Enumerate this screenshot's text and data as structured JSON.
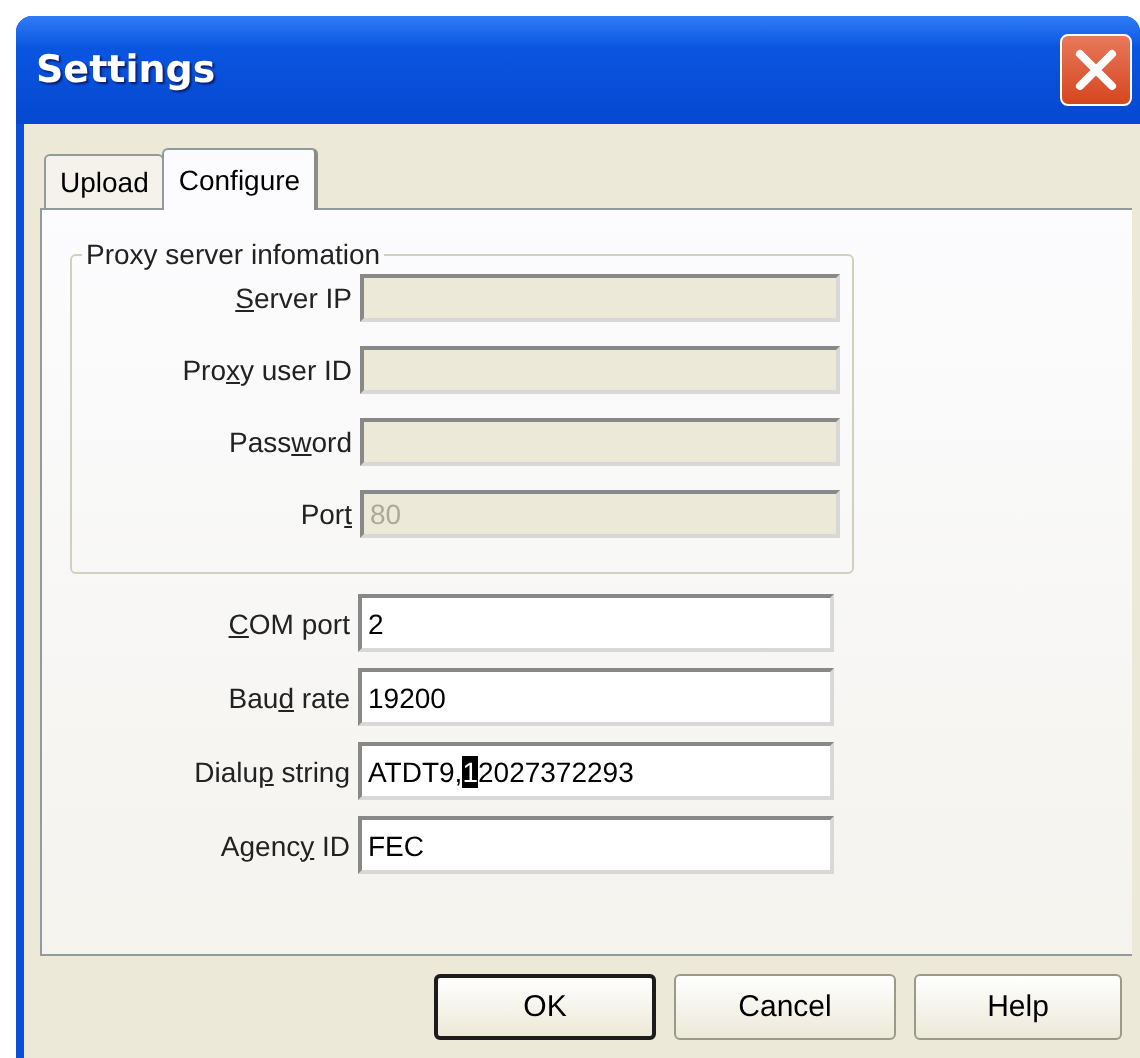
{
  "window": {
    "title": "Settings"
  },
  "tabs": [
    {
      "label": "Upload",
      "selected": false
    },
    {
      "label": "Configure",
      "selected": true
    }
  ],
  "proxy_group": {
    "title": "Proxy server infomation",
    "fields": [
      {
        "label": [
          {
            "text": "S",
            "underlined": true
          },
          {
            "text": "erver IP",
            "underlined": false
          }
        ],
        "disabled": true
      },
      {
        "label": [
          {
            "text": "Pro",
            "underlined": false
          },
          {
            "text": "x",
            "underlined": true
          },
          {
            "text": "y user ID",
            "underlined": false
          }
        ],
        "disabled": true
      },
      {
        "label": [
          {
            "text": "Pass",
            "underlined": false
          },
          {
            "text": "w",
            "underlined": true
          },
          {
            "text": "ord",
            "underlined": false
          }
        ],
        "disabled": true
      },
      {
        "label": [
          {
            "text": "Por",
            "underlined": false
          },
          {
            "text": "t",
            "underlined": true
          }
        ],
        "value": "80",
        "disabled": true
      }
    ]
  },
  "fields": [
    {
      "label": [
        {
          "text": "C",
          "underlined": true
        },
        {
          "text": "OM port",
          "underlined": false
        }
      ],
      "segments": [
        {
          "text": "2",
          "selected": false
        }
      ]
    },
    {
      "label": [
        {
          "text": "Bau",
          "underlined": false
        },
        {
          "text": "d",
          "underlined": true
        },
        {
          "text": " rate",
          "underlined": false
        }
      ],
      "segments": [
        {
          "text": "19200",
          "selected": false
        }
      ]
    },
    {
      "label": [
        {
          "text": "Dialu",
          "underlined": false
        },
        {
          "text": "p",
          "underlined": true
        },
        {
          "text": " string",
          "underlined": false
        }
      ],
      "segments": [
        {
          "text": "ATDT9,",
          "selected": false
        },
        {
          "text": "1",
          "selected": true
        },
        {
          "text": "2027372293",
          "selected": false
        }
      ]
    },
    {
      "label": [
        {
          "text": "Agenc",
          "underlined": false
        },
        {
          "text": "y",
          "underlined": true
        },
        {
          "text": " ID",
          "underlined": false
        }
      ],
      "segments": [
        {
          "text": "FEC",
          "selected": false
        }
      ]
    }
  ],
  "buttons": [
    {
      "label": "OK",
      "default": true
    },
    {
      "label": "Cancel",
      "default": false
    },
    {
      "label": "Help",
      "default": false
    }
  ]
}
